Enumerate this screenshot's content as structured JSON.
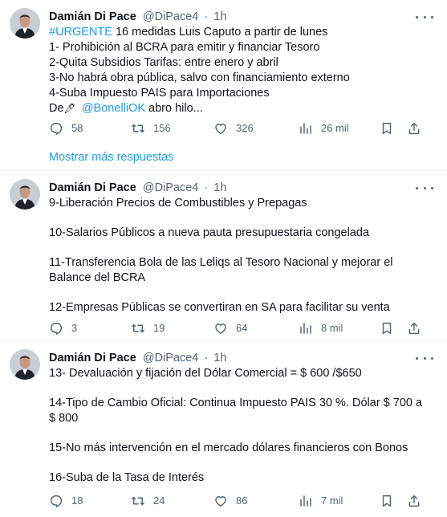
{
  "tweets": [
    {
      "author": {
        "name": "Damián Di Pace",
        "handle": "@DiPace4",
        "time": "1h"
      },
      "hashtag": "#URGENTE",
      "lines": [
        " 16 medidas Luis Caputo a partir de lunes",
        "1- Prohibición al BCRA para emitir y financiar Tesoro",
        "2-Quita Subsidios Tarifas: entre enero y abril",
        "3-No habrá obra pública, salvo con financiamiento externo",
        "4-Suba Impuesto PAIS para Importaciones"
      ],
      "last_line": {
        "prefix": "De",
        "emoji": "🖋",
        "mention": "@BonelliOK",
        "suffix": " abro hilo..."
      },
      "stats": {
        "replies": "58",
        "retweets": "156",
        "likes": "326",
        "views": "26 mil"
      }
    },
    {
      "author": {
        "name": "Damián Di Pace",
        "handle": "@DiPace4",
        "time": "1h"
      },
      "paragraphs": [
        "9-Liberación Precios de Combustibles y Prepagas",
        "10-Salarios Públicos a nueva pauta presupuestaria congelada",
        "11-Transferencia Bola de las Leliqs al Tesoro Nacional y mejorar el Balance del BCRA",
        "12-Empresas Públicas se convertiran en SA para facilitar su venta"
      ],
      "stats": {
        "replies": "3",
        "retweets": "19",
        "likes": "64",
        "views": "8 mil"
      }
    },
    {
      "author": {
        "name": "Damián Di Pace",
        "handle": "@DiPace4",
        "time": "1h"
      },
      "paragraphs": [
        "13- Devaluación y fijación del Dólar Comercial = $ 600 /$650",
        "14-Tipo de Cambio Oficial: Continua Impuesto PAIS 30 %. Dólar $ 700 a $ 800",
        "15-No más intervención en el mercado dólares financieros con Bonos",
        "16-Suba de la Tasa de Interés"
      ],
      "stats": {
        "replies": "18",
        "retweets": "24",
        "likes": "86",
        "views": "7 mil"
      }
    }
  ],
  "show_more_label": "Mostrar más respuestas",
  "colors": {
    "link": "#1d9bf0",
    "text": "#0f1419",
    "secondary": "#536471",
    "divider": "#eff3f4"
  },
  "icons": [
    "reply-icon",
    "retweet-icon",
    "like-icon",
    "views-icon",
    "bookmark-icon",
    "share-icon",
    "more-icon"
  ]
}
